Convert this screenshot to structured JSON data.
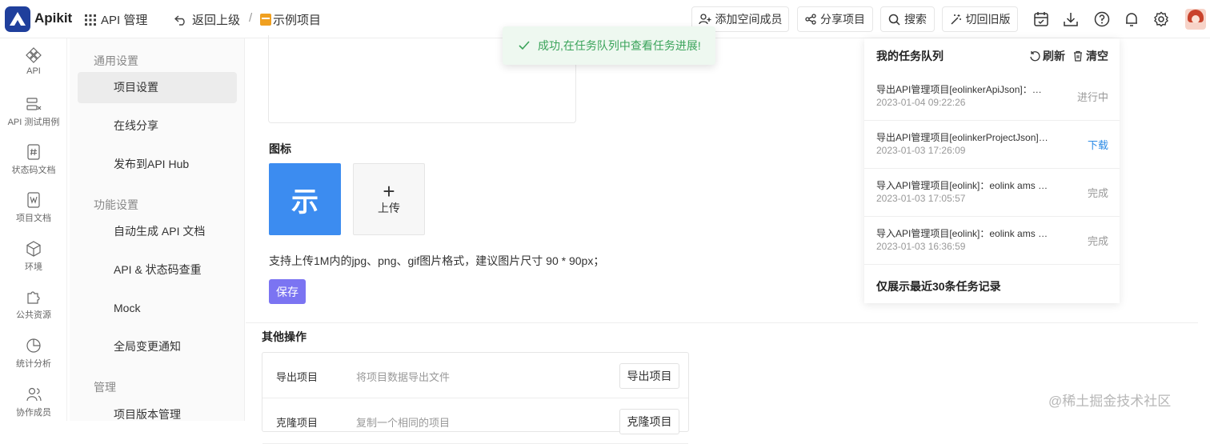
{
  "header": {
    "brand": "Apikit",
    "menu_api": "API 管理",
    "back_label": "返回上级",
    "separator": "/",
    "project_name": "示例项目",
    "add_member": "添加空间成员",
    "share_project": "分享项目",
    "search": "搜索",
    "switch_old": "切回旧版"
  },
  "leftnav": [
    {
      "label": "API",
      "icon": "api-icon"
    },
    {
      "label": "API 测试用例",
      "icon": "test-case-icon"
    },
    {
      "label": "状态码文档",
      "icon": "status-code-icon"
    },
    {
      "label": "项目文档",
      "icon": "document-icon"
    },
    {
      "label": "环境",
      "icon": "environment-icon"
    },
    {
      "label": "公共资源",
      "icon": "puzzle-icon"
    },
    {
      "label": "统计分析",
      "icon": "pie-chart-icon"
    },
    {
      "label": "协作成员",
      "icon": "members-icon"
    }
  ],
  "sidemenu": {
    "group_general": "通用设置",
    "item_project_settings": "项目设置",
    "item_online_share": "在线分享",
    "item_publish_hub": "发布到API Hub",
    "group_features": "功能设置",
    "item_auto_doc": "自动生成 API 文档",
    "item_dedupe": "API & 状态码查重",
    "item_mock": "Mock",
    "item_change_notice": "全局变更通知",
    "group_manage": "管理",
    "item_version": "项目版本管理"
  },
  "main": {
    "icon_section": "图标",
    "icon_char": "示",
    "upload_plus": "+",
    "upload_label": "上传",
    "hint": "支持上传1M内的jpg、png、gif图片格式，建议图片尺寸 90 * 90px；",
    "save": "保存",
    "other_ops": "其他操作",
    "ops": [
      {
        "name": "导出项目",
        "desc": "将项目数据导出文件",
        "button": "导出项目"
      },
      {
        "name": "克隆项目",
        "desc": "复制一个相同的项目",
        "button": "克隆项目"
      }
    ]
  },
  "toast": {
    "message": "成功,在任务队列中查看任务进展!"
  },
  "queue": {
    "title": "我的任务队列",
    "refresh": "刷新",
    "clear": "清空",
    "tasks": [
      {
        "name": "导出API管理项目[eolinkerApiJson]：示例项目",
        "time": "2023-01-04 09:22:26",
        "status": "进行中"
      },
      {
        "name": "导出API管理项目[eolinkerProjectJson]：示例项目",
        "time": "2023-01-03 17:26:09",
        "status": "下载"
      },
      {
        "name": "导入API管理项目[eolink]：eolink ams 示例项目",
        "time": "2023-01-03 17:05:57",
        "status": "完成"
      },
      {
        "name": "导入API管理项目[eolink]：eolink ams 示例项目",
        "time": "2023-01-03 16:36:59",
        "status": "完成"
      }
    ],
    "footer": "仅展示最近30条任务记录"
  },
  "watermark": "@稀土掘金技术社区",
  "colors": {
    "brand": "#1f3f9c",
    "accent": "#7b74f2",
    "icon_blue": "#3c8cf0",
    "success": "#3aa35a",
    "link": "#2b8be6"
  }
}
